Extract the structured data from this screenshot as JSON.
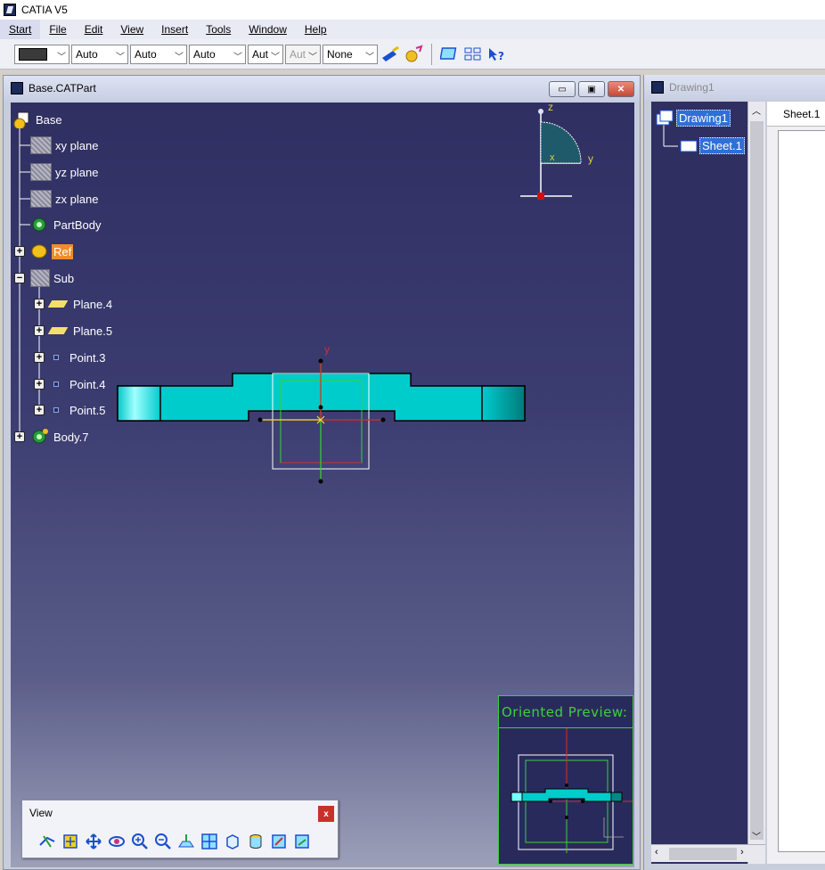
{
  "app": {
    "title": "CATIA V5"
  },
  "menu": [
    "Start",
    "File",
    "Edit",
    "View",
    "Insert",
    "Tools",
    "Window",
    "Help"
  ],
  "toolbar": {
    "selects": [
      "Auto",
      "Auto",
      "Auto",
      "Aut",
      "Aut",
      "None"
    ]
  },
  "part_window": {
    "title": "Base.CATPart",
    "tree": {
      "root": "Base",
      "items": [
        "xy plane",
        "yz plane",
        "zx plane",
        "PartBody",
        "Ref",
        "Sub",
        "Plane.4",
        "Plane.5",
        "Point.3",
        "Point.4",
        "Point.5",
        "Body.7"
      ]
    },
    "compass": {
      "z": "z",
      "y": "y",
      "x": "x"
    },
    "axis_label": "y"
  },
  "view_toolbar": {
    "title": "View",
    "close": "x"
  },
  "preview": {
    "title": "Oriented Preview:"
  },
  "drawing_window": {
    "title": "Drawing1",
    "tree": [
      "Drawing1",
      "Sheet.1"
    ],
    "sheet_tab": "Sheet.1"
  },
  "colors": {
    "part_fill": "#00cccc",
    "highlight": "#f08c2a",
    "preview_border": "#3ccf3c"
  }
}
